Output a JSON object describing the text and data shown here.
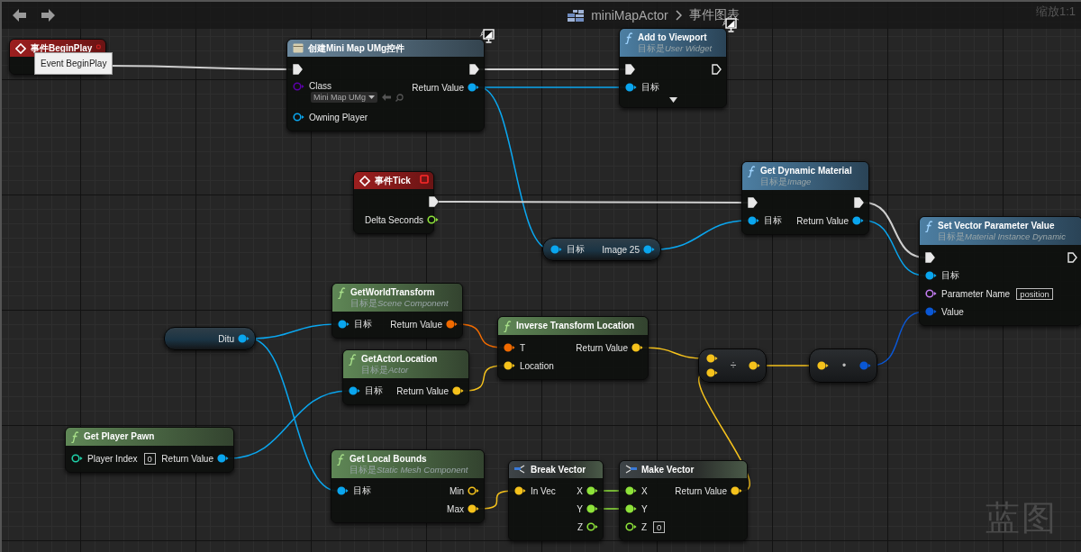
{
  "title_bar": {
    "blueprint": "miniMapActor",
    "graph": "事件图表",
    "zoom": "缩放1:1"
  },
  "nodes": [
    {
      "kind": "event",
      "title": "事件BeginPlay"
    },
    {
      "kind": "construct",
      "title": "创建Mini Map UMg控件",
      "monitor_badge": true,
      "inputs": [
        {
          "kind": "exec",
          "connected": true
        },
        {
          "kind": "class",
          "label": "Class",
          "connected": false,
          "dropdown": "Mini Map UMg"
        },
        {
          "kind": "object",
          "label": "Owning Player",
          "connected": false
        }
      ],
      "outputs": [
        {
          "kind": "exec",
          "connected": true
        },
        {
          "kind": "object",
          "label": "Return Value",
          "connected": true
        }
      ]
    },
    {
      "kind": "function",
      "title": "Add to Viewport",
      "subtitle": {
        "prefix": "目标是",
        "target": "User Widget"
      },
      "monitor_badge": true,
      "expandable": true,
      "inputs": [
        {
          "kind": "exec",
          "connected": true
        },
        {
          "kind": "object",
          "label": "目标",
          "connected": true
        }
      ],
      "outputs": [
        {
          "kind": "exec",
          "connected": false
        }
      ]
    },
    {
      "kind": "event",
      "title": "事件Tick",
      "outputs": [
        {
          "kind": "exec",
          "connected": true
        },
        {
          "kind": "float",
          "label": "Delta Seconds",
          "connected": false
        }
      ]
    },
    {
      "kind": "function",
      "title": "Get Dynamic Material",
      "subtitle": {
        "prefix": "目标是",
        "target": "Image"
      },
      "inputs": [
        {
          "kind": "exec",
          "connected": true
        },
        {
          "kind": "object",
          "label": "目标",
          "connected": true
        }
      ],
      "outputs": [
        {
          "kind": "exec",
          "connected": true
        },
        {
          "kind": "object",
          "label": "Return Value",
          "connected": true
        }
      ]
    },
    {
      "kind": "variable",
      "inputs": [
        {
          "kind": "object",
          "label": "目标",
          "connected": true
        }
      ],
      "outputs": [
        {
          "kind": "object",
          "label": "Image 25",
          "connected": true
        }
      ]
    },
    {
      "kind": "function",
      "title": "Set Vector Parameter Value",
      "subtitle": {
        "prefix": "目标是",
        "target": "Material Instance Dynamic"
      },
      "inputs": [
        {
          "kind": "exec",
          "connected": true
        },
        {
          "kind": "object",
          "label": "目标",
          "connected": true
        },
        {
          "kind": "name",
          "label": "Parameter Name",
          "connected": false,
          "value": "position"
        },
        {
          "kind": "color",
          "label": "Value",
          "connected": true
        }
      ],
      "outputs": [
        {
          "kind": "exec",
          "connected": false
        }
      ]
    },
    {
      "kind": "pure",
      "title": "GetWorldTransform",
      "subtitle": {
        "prefix": "目标是",
        "target": "Scene Component"
      },
      "inputs": [
        {
          "kind": "object",
          "label": "目标",
          "connected": true
        }
      ],
      "outputs": [
        {
          "kind": "transform",
          "label": "Return Value",
          "connected": true
        }
      ]
    },
    {
      "kind": "pure",
      "title": "Inverse Transform Location",
      "inputs": [
        {
          "kind": "transform",
          "label": "T",
          "connected": true
        },
        {
          "kind": "vector",
          "label": "Location",
          "connected": true
        }
      ],
      "outputs": [
        {
          "kind": "vector",
          "label": "Return Value",
          "connected": true
        }
      ]
    },
    {
      "kind": "variable",
      "outputs": [
        {
          "kind": "object",
          "label": "Ditu",
          "connected": true
        }
      ]
    },
    {
      "kind": "pure",
      "title": "GetActorLocation",
      "subtitle": {
        "prefix": "目标是",
        "target": "Actor"
      },
      "inputs": [
        {
          "kind": "object",
          "label": "目标",
          "connected": true
        }
      ],
      "outputs": [
        {
          "kind": "vector",
          "label": "Return Value",
          "connected": true
        }
      ]
    },
    {
      "kind": "operator",
      "symbol": "÷",
      "inputs": [
        {
          "kind": "vector",
          "connected": true
        },
        {
          "kind": "vector",
          "connected": true
        }
      ],
      "outputs": [
        {
          "kind": "vector",
          "connected": true
        }
      ]
    },
    {
      "kind": "operator",
      "symbol": "•",
      "inputs": [
        {
          "kind": "vector",
          "connected": true
        }
      ],
      "outputs": [
        {
          "kind": "color",
          "connected": true
        }
      ]
    },
    {
      "kind": "pure",
      "title": "Get Player Pawn",
      "inputs": [
        {
          "kind": "int",
          "label": "Player Index",
          "connected": false,
          "value": "0"
        }
      ],
      "outputs": [
        {
          "kind": "object",
          "label": "Return Value",
          "connected": true
        }
      ]
    },
    {
      "kind": "pure",
      "title": "Get Local Bounds",
      "subtitle": {
        "prefix": "目标是",
        "target": "Static Mesh Component"
      },
      "inputs": [
        {
          "kind": "object",
          "label": "目标",
          "connected": true
        }
      ],
      "outputs": [
        {
          "kind": "vector",
          "label": "Min",
          "connected": false
        },
        {
          "kind": "vector",
          "label": "Max",
          "connected": true
        }
      ]
    },
    {
      "kind": "break",
      "title": "Break Vector",
      "inputs": [
        {
          "kind": "vector",
          "label": "In Vec",
          "connected": true
        }
      ],
      "outputs": [
        {
          "kind": "float",
          "label": "X",
          "connected": true
        },
        {
          "kind": "float",
          "label": "Y",
          "connected": true
        },
        {
          "kind": "float",
          "label": "Z",
          "connected": false
        }
      ]
    },
    {
      "kind": "make",
      "title": "Make Vector",
      "inputs": [
        {
          "kind": "float",
          "label": "X",
          "connected": true
        },
        {
          "kind": "float",
          "label": "Y",
          "connected": true
        },
        {
          "kind": "float",
          "label": "Z",
          "connected": false,
          "value": "0"
        }
      ],
      "outputs": [
        {
          "kind": "vector",
          "label": "Return Value",
          "connected": true
        }
      ]
    }
  ],
  "tooltip": {
    "text": "Event BeginPlay"
  },
  "watermark": "蓝图"
}
